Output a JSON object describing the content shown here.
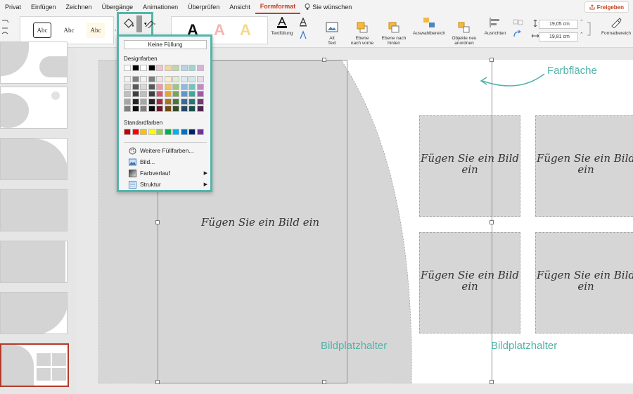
{
  "tabs": [
    "Privat",
    "Einfügen",
    "Zeichnen",
    "Übergänge",
    "Animationen",
    "Überprüfen",
    "Ansicht",
    "Formformat"
  ],
  "active_tab": "Formformat",
  "tell_me": "Sie wünschen",
  "share_label": "Freigeben",
  "ribbon": {
    "style_samples": [
      "Abc",
      "Abc",
      "Abc"
    ],
    "wordart_sample": "A",
    "textfuellung": "Textfüllung",
    "alt_text": "Alt\nText",
    "ebene_vorne": "Ebene\nnach vorne",
    "ebene_hinten": "Ebene nach\nhinten",
    "auswahlbereich": "Auswahlbereich",
    "objekte_anordnen": "Objekte neu\nanordnen",
    "ausrichten": "Ausrichten",
    "height": "19,05 cm",
    "width": "19,81 cm",
    "formatbereich": "Formatbereich"
  },
  "popup": {
    "no_fill": "Keine Füllung",
    "theme_colors_label": "Designfarben",
    "standard_colors_label": "Standardfarben",
    "theme_top": [
      "#ffffff",
      "#000000",
      "#ffffff",
      "#000000",
      "#f2c2c8",
      "#f4d79a",
      "#bcd7a8",
      "#b7d2ea",
      "#9ad7d2",
      "#d6b4d9"
    ],
    "theme_shades": [
      [
        "#f2f2f2",
        "#7f7f7f",
        "#f2f2f2",
        "#7f7f7f",
        "#f8dfe2",
        "#f9ebcd",
        "#dfecd4",
        "#dbe9f5",
        "#cdebe8",
        "#ebdaec"
      ],
      [
        "#d9d9d9",
        "#595959",
        "#d9d9d9",
        "#595959",
        "#ee9aa4",
        "#f0c26a",
        "#9fc585",
        "#8fb9de",
        "#6ec6bf",
        "#c08ac5"
      ],
      [
        "#bfbfbf",
        "#404040",
        "#bfbfbf",
        "#404040",
        "#d9536a",
        "#e0a53a",
        "#76a55a",
        "#5f96c8",
        "#3da69e",
        "#9f5ba6"
      ],
      [
        "#a6a6a6",
        "#262626",
        "#a6a6a6",
        "#262626",
        "#a8283f",
        "#a7741b",
        "#4e7438",
        "#386c9b",
        "#237873",
        "#6f3878"
      ],
      [
        "#7f7f7f",
        "#0d0d0d",
        "#7f7f7f",
        "#0d0d0d",
        "#6f1829",
        "#6f4c10",
        "#344d25",
        "#254867",
        "#17504c",
        "#4a2550"
      ]
    ],
    "standard_colors": [
      "#c00000",
      "#ff0000",
      "#ffc000",
      "#ffff00",
      "#92d050",
      "#00b050",
      "#00b0f0",
      "#0070c0",
      "#002060",
      "#7030a0"
    ],
    "menu_items": [
      {
        "label": "Weitere Füllfarben...",
        "submenu": false,
        "icon": "color-wheel-icon"
      },
      {
        "label": "Bild...",
        "submenu": false,
        "icon": "picture-icon"
      },
      {
        "label": "Farbverlauf",
        "submenu": true,
        "icon": "gradient-icon"
      },
      {
        "label": "Struktur",
        "submenu": true,
        "icon": "texture-icon"
      }
    ]
  },
  "slide": {
    "placeholder_text": "Fügen Sie ein Bild ein",
    "placeholder_text_small": "Fügen Sie ein Bild ein",
    "label_colorarea": "Farbfläche",
    "label_placeholder_1": "Bildplatzhalter",
    "label_placeholder_2": "Bildplatzhalter"
  },
  "colors": {
    "accent": "#c43e1c",
    "teal": "#4fb3a9",
    "placeholder": "#d6d6d6"
  }
}
